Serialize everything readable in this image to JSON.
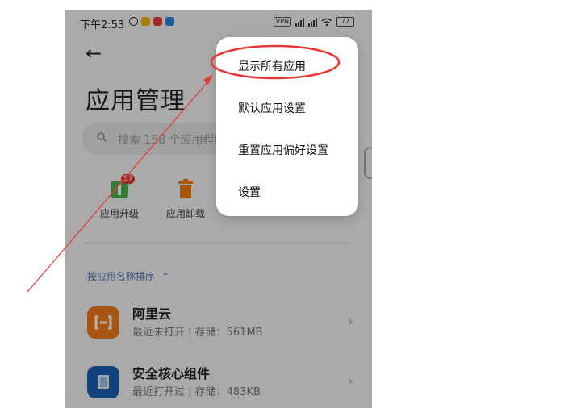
{
  "status": {
    "time": "下午2:53",
    "vpn": "VPN",
    "battery": "77"
  },
  "nav": {
    "back_glyph": "←"
  },
  "page": {
    "title": "应用管理"
  },
  "search": {
    "placeholder": "搜索 158 个应用程序"
  },
  "tools": [
    {
      "label": "应用升级",
      "badge": "57",
      "icon": "upgrade-icon",
      "color": "#4caf50"
    },
    {
      "label": "应用卸载",
      "icon": "trash-icon",
      "color": "#f57c00"
    }
  ],
  "sort": {
    "label": "按应用名称排序",
    "arrow": "⌃"
  },
  "apps": [
    {
      "name": "阿里云",
      "meta": "最近未打开 | 存储：561MB",
      "icon_color": "#f27a1a",
      "chevron": "›"
    },
    {
      "name": "安全核心组件",
      "meta": "最近打开过 | 存储：483KB",
      "icon_color": "#1e5fb4",
      "chevron": "›"
    }
  ],
  "menu": {
    "items": [
      {
        "label": "显示所有应用"
      },
      {
        "label": "默认应用设置"
      },
      {
        "label": "重置应用偏好设置"
      },
      {
        "label": "设置"
      }
    ]
  },
  "colors": {
    "annotation": "#e53935",
    "sort_text": "#4a6fa5"
  }
}
